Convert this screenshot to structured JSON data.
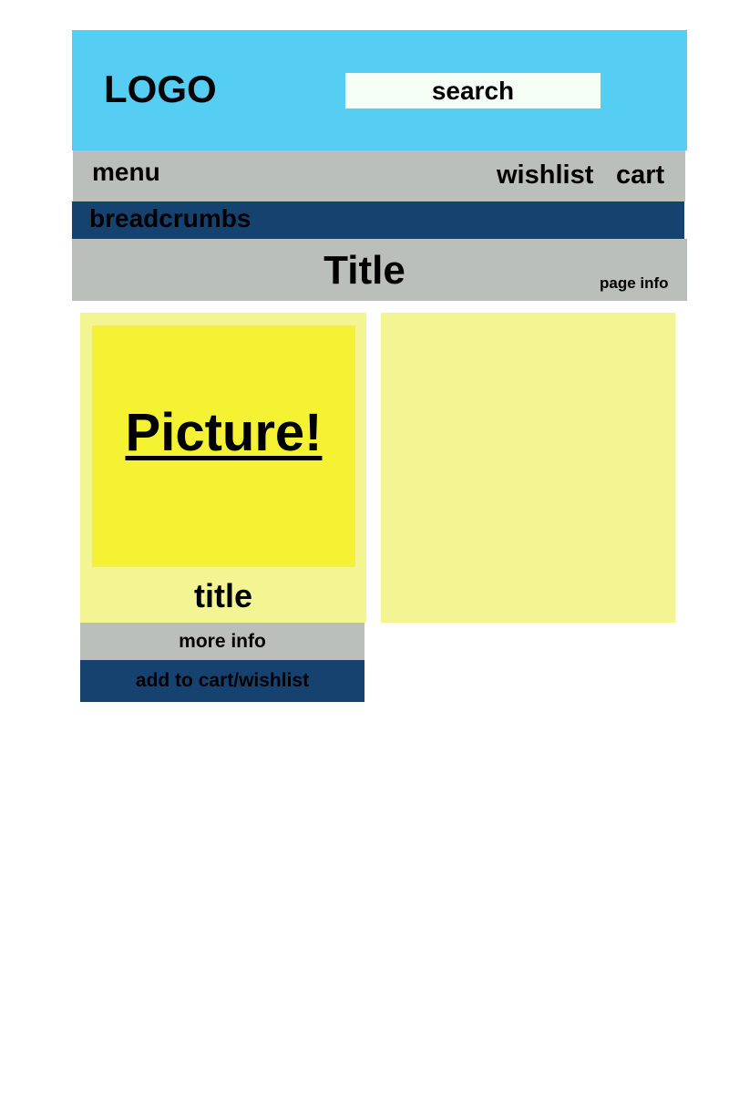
{
  "header": {
    "logo": "LOGO",
    "search_label": "search"
  },
  "nav": {
    "menu": "menu",
    "wishlist": "wishlist",
    "cart": "cart"
  },
  "breadcrumbs": "breadcrumbs",
  "title_bar": {
    "title": "Title",
    "page_info": "page info"
  },
  "product": {
    "picture_label": "Picture!",
    "title": "title",
    "more_info": "more info",
    "add_to_cart": "add to cart/wishlist"
  },
  "colors": {
    "header_bg": "#56cdf3",
    "search_bg": "#f5fff5",
    "gray_bar": "#bbbfbc",
    "navy_bar": "#164270",
    "card_bg": "#f2f592",
    "picture_bg": "#f4f232"
  }
}
